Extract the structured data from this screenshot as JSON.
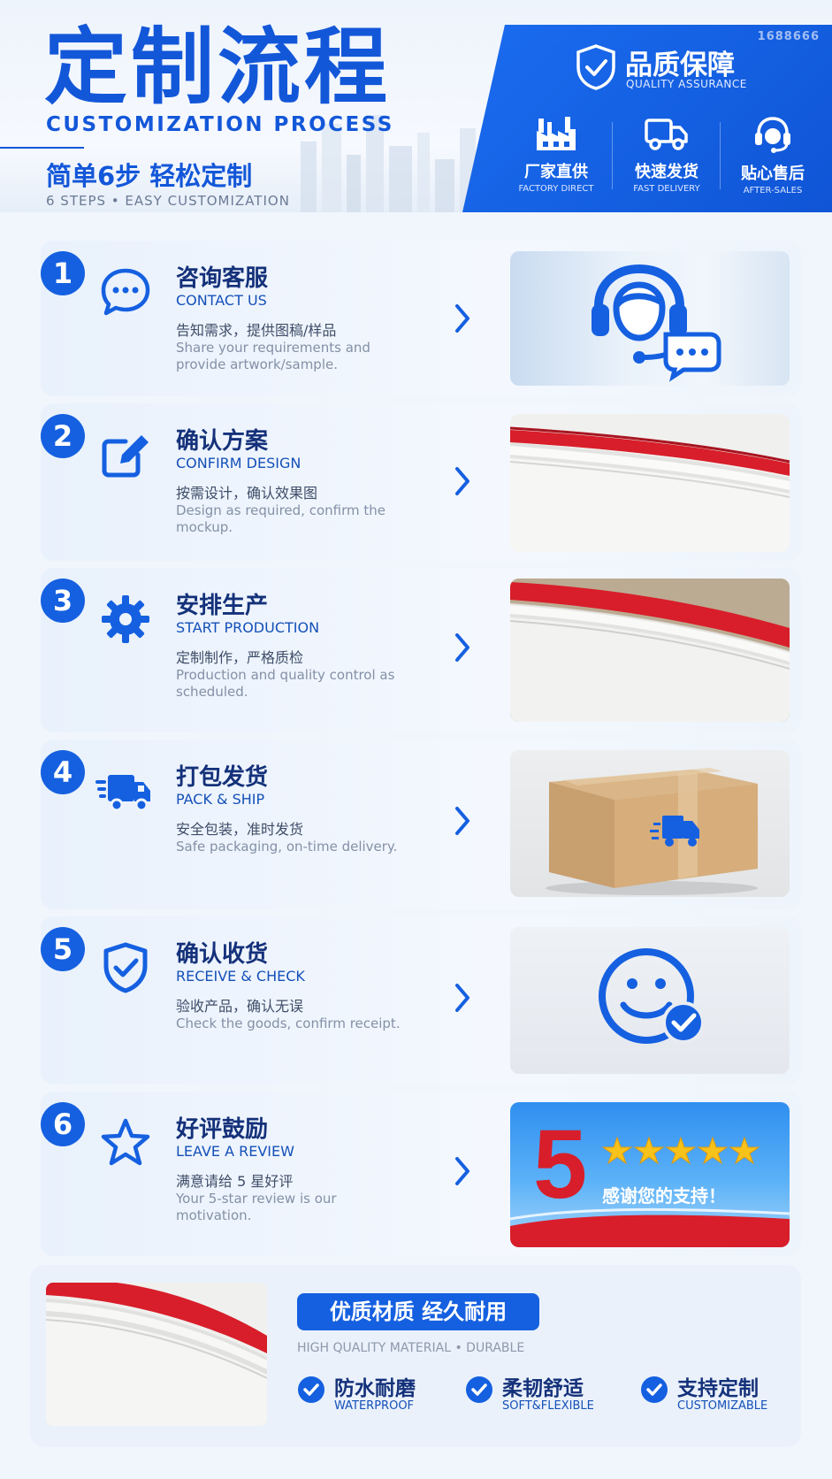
{
  "header": {
    "title": "定制流程",
    "title_en": "CUSTOMIZATION PROCESS",
    "subtitle": "简单6步 轻松定制",
    "subtitle_en": "6 STEPS • EASY CUSTOMIZATION",
    "watermark": "1688666"
  },
  "quality": {
    "title": "品质保障",
    "subtitle": "QUALITY ASSURANCE",
    "features": [
      {
        "cn": "厂家直供",
        "en": "FACTORY DIRECT",
        "icon": "factory-icon"
      },
      {
        "cn": "快速发货",
        "en": "FAST DELIVERY",
        "icon": "truck-icon"
      },
      {
        "cn": "贴心售后",
        "en": "AFTER-SALES",
        "icon": "headset-icon"
      }
    ]
  },
  "steps": [
    {
      "num": "1",
      "cn": "咨询客服",
      "en": "CONTACT US",
      "desc_cn": "告知需求，提供图稿/样品",
      "desc_en": "Share your requirements and provide artwork/sample.",
      "icon": "chat-bubble-icon"
    },
    {
      "num": "2",
      "cn": "确认方案",
      "en": "CONFIRM DESIGN",
      "desc_cn": "按需设计，确认效果图",
      "desc_en": "Design as required, confirm the mockup.",
      "icon": "edit-icon"
    },
    {
      "num": "3",
      "cn": "安排生产",
      "en": "START PRODUCTION",
      "desc_cn": "定制制作，严格质检",
      "desc_en": "Production and quality control as scheduled.",
      "icon": "gear-icon"
    },
    {
      "num": "4",
      "cn": "打包发货",
      "en": "PACK & SHIP",
      "desc_cn": "安全包装，准时发货",
      "desc_en": "Safe packaging, on-time delivery.",
      "icon": "truck-icon"
    },
    {
      "num": "5",
      "cn": "确认收货",
      "en": "RECEIVE & CHECK",
      "desc_cn": "验收产品，确认无误",
      "desc_en": "Check the goods, confirm receipt.",
      "icon": "shield-check-icon"
    },
    {
      "num": "6",
      "cn": "好评鼓励",
      "en": "LEAVE A REVIEW",
      "desc_cn": "满意请给 5 星好评",
      "desc_en": "Your 5-star review is our motivation.",
      "icon": "star-icon"
    }
  ],
  "review_image": {
    "big_number": "5",
    "text": "感谢您的支持！"
  },
  "bottom": {
    "pill": "优质材质  经久耐用",
    "pill_sub": "HIGH QUALITY MATERIAL • DURABLE",
    "features": [
      {
        "cn": "防水耐磨",
        "en": "WATERPROOF"
      },
      {
        "cn": "柔韧舒适",
        "en": "SOFT&FLEXIBLE"
      },
      {
        "cn": "支持定制",
        "en": "CUSTOMIZABLE"
      }
    ]
  },
  "colors": {
    "brand_blue": "#1560e0",
    "accent_red": "#d81e2a",
    "star_gold": "#f7c21a"
  }
}
